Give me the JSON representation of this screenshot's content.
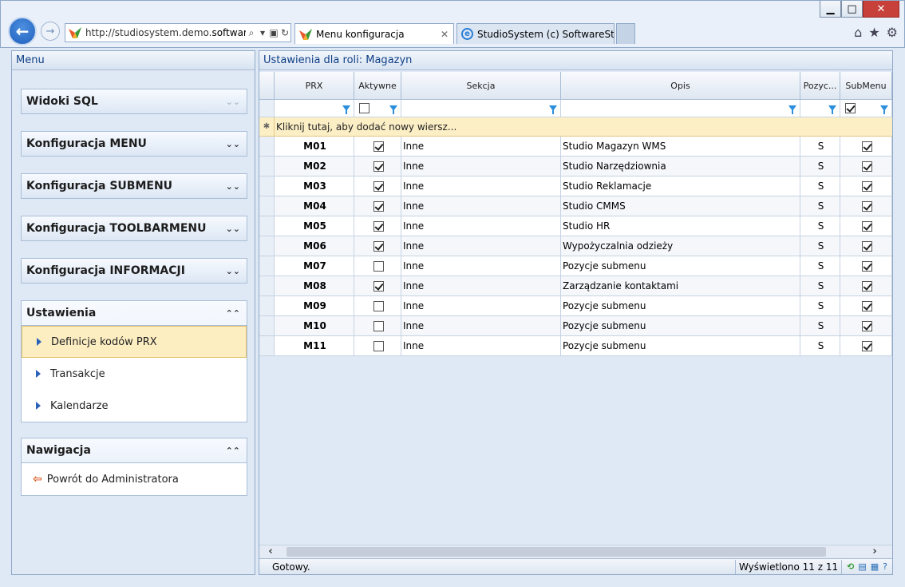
{
  "browser": {
    "url_prefix": "http://studiosystem.demo.",
    "url_domain": "softwar...",
    "tab_active": "Menu konfiguracja",
    "tab_other": "StudioSystem (c) SoftwareStud..."
  },
  "left_panel": {
    "title": "Menu",
    "sections": [
      {
        "title": "Widoki SQL"
      },
      {
        "title": "Konfiguracja MENU"
      },
      {
        "title": "Konfiguracja SUBMENU"
      },
      {
        "title": "Konfiguracja TOOLBARMENU"
      },
      {
        "title": "Konfiguracja INFORMACJI"
      }
    ],
    "ustawienia": {
      "title": "Ustawienia",
      "items": [
        "Definicje kodów PRX",
        "Transakcje",
        "Kalendarze"
      ]
    },
    "nawigacja": {
      "title": "Nawigacja",
      "items": [
        "Powrót do Administratora"
      ]
    }
  },
  "grid": {
    "title": "Ustawienia dla roli: Magazyn",
    "columns": [
      "PRX",
      "Aktywne",
      "Sekcja",
      "Opis",
      "Pozyc...",
      "SubMenu"
    ],
    "new_row_text": "Kliknij tutaj, aby dodać nowy wiersz...",
    "rows": [
      {
        "prx": "M01",
        "aktywne": true,
        "sekcja": "Inne",
        "opis": "Studio Magazyn WMS",
        "pozycja": "S",
        "submenu": true
      },
      {
        "prx": "M02",
        "aktywne": true,
        "sekcja": "Inne",
        "opis": "Studio Narzędziownia",
        "pozycja": "S",
        "submenu": true
      },
      {
        "prx": "M03",
        "aktywne": true,
        "sekcja": "Inne",
        "opis": "Studio Reklamacje",
        "pozycja": "S",
        "submenu": true
      },
      {
        "prx": "M04",
        "aktywne": true,
        "sekcja": "Inne",
        "opis": "Studio CMMS",
        "pozycja": "S",
        "submenu": true
      },
      {
        "prx": "M05",
        "aktywne": true,
        "sekcja": "Inne",
        "opis": "Studio HR",
        "pozycja": "S",
        "submenu": true
      },
      {
        "prx": "M06",
        "aktywne": true,
        "sekcja": "Inne",
        "opis": "Wypożyczalnia odzieży",
        "pozycja": "S",
        "submenu": true
      },
      {
        "prx": "M07",
        "aktywne": false,
        "sekcja": "Inne",
        "opis": "Pozycje submenu",
        "pozycja": "S",
        "submenu": true
      },
      {
        "prx": "M08",
        "aktywne": true,
        "sekcja": "Inne",
        "opis": "Zarządzanie kontaktami",
        "pozycja": "S",
        "submenu": true
      },
      {
        "prx": "M09",
        "aktywne": false,
        "sekcja": "Inne",
        "opis": "Pozycje submenu",
        "pozycja": "S",
        "submenu": true
      },
      {
        "prx": "M10",
        "aktywne": false,
        "sekcja": "Inne",
        "opis": "Pozycje submenu",
        "pozycja": "S",
        "submenu": true
      },
      {
        "prx": "M11",
        "aktywne": false,
        "sekcja": "Inne",
        "opis": "Pozycje submenu",
        "pozycja": "S",
        "submenu": true
      }
    ],
    "status": "Gotowy.",
    "count_text": "Wyświetlono 11 z 11"
  }
}
